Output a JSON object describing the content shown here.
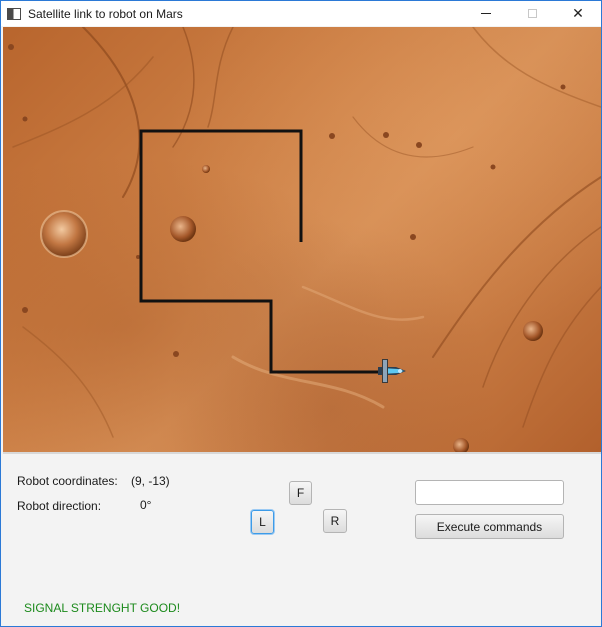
{
  "window": {
    "title": "Satellite link to robot on Mars"
  },
  "status": {
    "coordinates_label": "Robot coordinates:",
    "coordinates_value": "(9, -13)",
    "direction_label": "Robot direction:",
    "direction_value": "0°",
    "signal_text": "SIGNAL STRENGHT GOOD!",
    "signal_color": "#1c8a1c"
  },
  "controls": {
    "forward_label": "F",
    "left_label": "L",
    "right_label": "R",
    "command_input_value": "",
    "execute_label": "Execute commands"
  },
  "map": {
    "path_color": "#111111",
    "accent": "#2b79d6"
  }
}
